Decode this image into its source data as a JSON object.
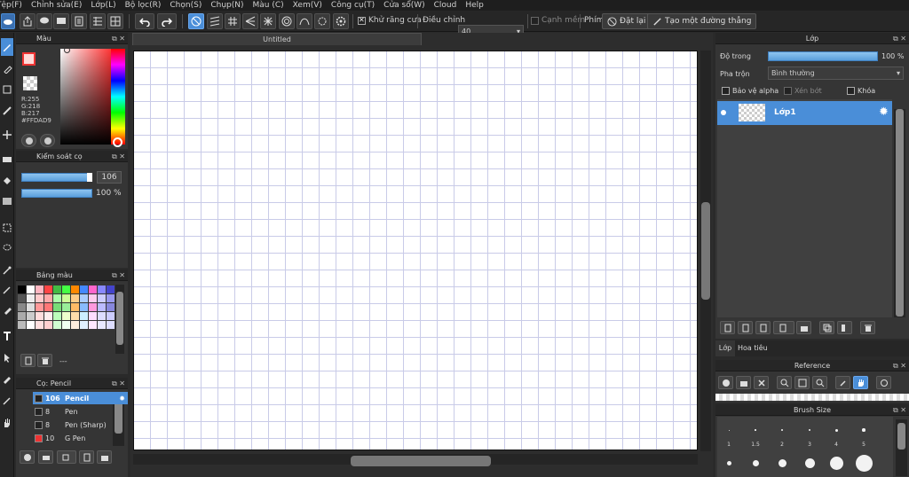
{
  "menu": [
    "Tệp(F)",
    "Chỉnh sửa(E)",
    "Lớp(L)",
    "Bộ lọc(R)",
    "Chọn(S)",
    "Chụp(N)",
    "Màu (C)",
    "Xem(V)",
    "Công cụ(T)",
    "Cửa sổ(W)",
    "Cloud",
    "Help"
  ],
  "toolbar": {
    "antialias_label": "Khử răng cưa",
    "adjust_label": "Điều chỉnh",
    "adjust_value": "40",
    "edge_smooth_label": "Cạnh mềm",
    "key_label": "Phím",
    "reset_label": "Đặt lại",
    "line_label": "Tạo một đường thẳng"
  },
  "color_panel": {
    "title": "Màu",
    "r": "R:255",
    "g": "G:218",
    "b": "B:217",
    "hex": "#FFDAD9",
    "fg_color": "#FFDAD9"
  },
  "brush_control": {
    "title": "Kiểm soát cọ",
    "size": "106",
    "opacity": "100 %",
    "size_fraction": 0.95,
    "opacity_fraction": 1.0
  },
  "palette": {
    "title": "Bảng màu",
    "name": "---",
    "colors": [
      "#000000",
      "#ffffff",
      "#ffb6c1",
      "#ff4444",
      "#44bb44",
      "#44ff44",
      "#ff8800",
      "#4488ff",
      "#ff66cc",
      "#8888ff",
      "#4444cc",
      "#555555",
      "#eeeeee",
      "#ffcccc",
      "#ffaaaa",
      "#aaffaa",
      "#ccff99",
      "#ffcc88",
      "#aaccff",
      "#ffccee",
      "#ccccff",
      "#9999ee",
      "#888888",
      "#dddddd",
      "#ff9999",
      "#ff7777",
      "#77dd77",
      "#99ee99",
      "#ffbb66",
      "#88bbff",
      "#ff99dd",
      "#bbbbff",
      "#8888dd",
      "#aaaaaa",
      "#cccccc",
      "#ffdddd",
      "#ffeeee",
      "#bbffbb",
      "#eeffcc",
      "#ffddaa",
      "#cceeff",
      "#ffddff",
      "#ddddff",
      "#ccccff",
      "#bbbbbb",
      "#ffffff",
      "#ffe0e0",
      "#ffd0d0",
      "#d0ffd0",
      "#f0fff0",
      "#ffeedd",
      "#e0f0ff",
      "#ffe8ff",
      "#e8e8ff",
      "#ddddff"
    ]
  },
  "brushes": {
    "title": "Cọ: Pencil",
    "items": [
      {
        "size": "106",
        "name": "Pencil",
        "color": "#222222",
        "selected": true
      },
      {
        "size": "8",
        "name": "Pen",
        "color": "#222222",
        "selected": false
      },
      {
        "size": "8",
        "name": "Pen (Sharp)",
        "color": "#222222",
        "selected": false
      },
      {
        "size": "10",
        "name": "G Pen",
        "color": "#ee3333",
        "selected": false
      }
    ]
  },
  "document": {
    "tab": "Untitled"
  },
  "layer_panel": {
    "title": "Lớp",
    "opacity_label": "Độ trong",
    "opacity_value": "100 %",
    "opacity_fraction": 1.0,
    "blend_label": "Pha trộn",
    "blend_value": "Bình thường",
    "protect_alpha": "Bảo vệ alpha",
    "clipping": "Xén bớt",
    "lock": "Khóa",
    "layers": [
      {
        "name": "Lớp1"
      }
    ],
    "tab_layer": "Lớp",
    "tab_nav": "Hoa tiêu"
  },
  "reference": {
    "title": "Reference"
  },
  "brush_size": {
    "title": "Brush Size",
    "row1_labels": [
      "1",
      "1.5",
      "2",
      "3",
      "4",
      "5"
    ]
  },
  "colors": {
    "accent": "#4a8ed8",
    "panel_bg": "#353535",
    "header_bg": "#262626"
  }
}
